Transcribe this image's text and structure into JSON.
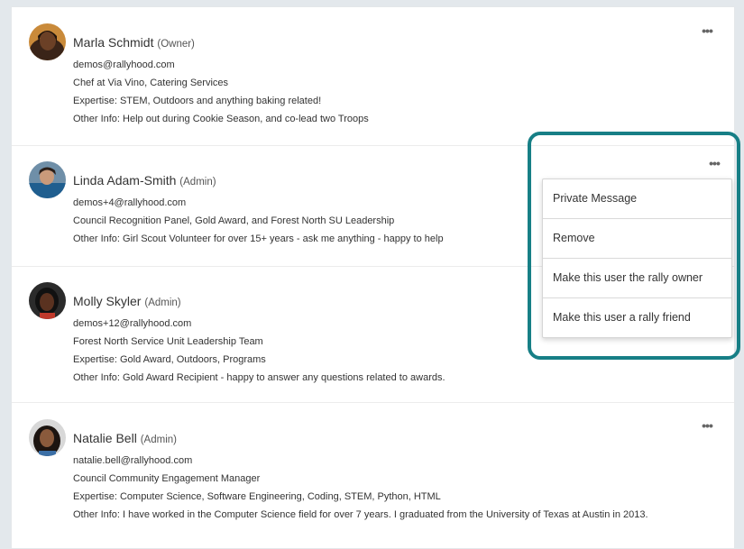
{
  "members": [
    {
      "name": "Marla Schmidt",
      "role": "(Owner)",
      "lines": [
        "demos@rallyhood.com",
        "Chef at Via Vino, Catering Services",
        "Expertise: STEM, Outdoors and anything baking related!",
        "Other Info: Help out during Cookie Season, and co-lead two Troops"
      ],
      "more_icon": "more-horizontal-icon"
    },
    {
      "name": "Linda Adam-Smith",
      "role": "(Admin)",
      "lines": [
        "demos+4@rallyhood.com",
        "Council Recognition Panel, Gold Award, and Forest North SU Leadership",
        "Other Info: Girl Scout Volunteer for over 15+ years - ask me anything - happy to help"
      ],
      "more_icon": "more-horizontal-icon"
    },
    {
      "name": "Molly Skyler",
      "role": "(Admin)",
      "lines": [
        "demos+12@rallyhood.com",
        "Forest North Service Unit Leadership Team",
        "Expertise: Gold Award, Outdoors, Programs",
        "Other Info: Gold Award Recipient - happy to answer any questions related to awards."
      ]
    },
    {
      "name": "Natalie Bell",
      "role": "(Admin)",
      "lines": [
        "natalie.bell@rallyhood.com",
        "Council Community Engagement Manager",
        "Expertise: Computer Science, Software Engineering, Coding, STEM, Python, HTML",
        "Other Info: I have worked in the Computer Science field for over 7 years. I graduated from the University of Texas at Austin in 2013."
      ],
      "more_icon": "more-horizontal-icon"
    }
  ],
  "menu": {
    "items": [
      "Private Message",
      "Remove",
      "Make this user the rally owner",
      "Make this user a rally friend"
    ]
  },
  "colors": {
    "highlight_border": "#177f86",
    "page_background": "#e3e8ec"
  }
}
